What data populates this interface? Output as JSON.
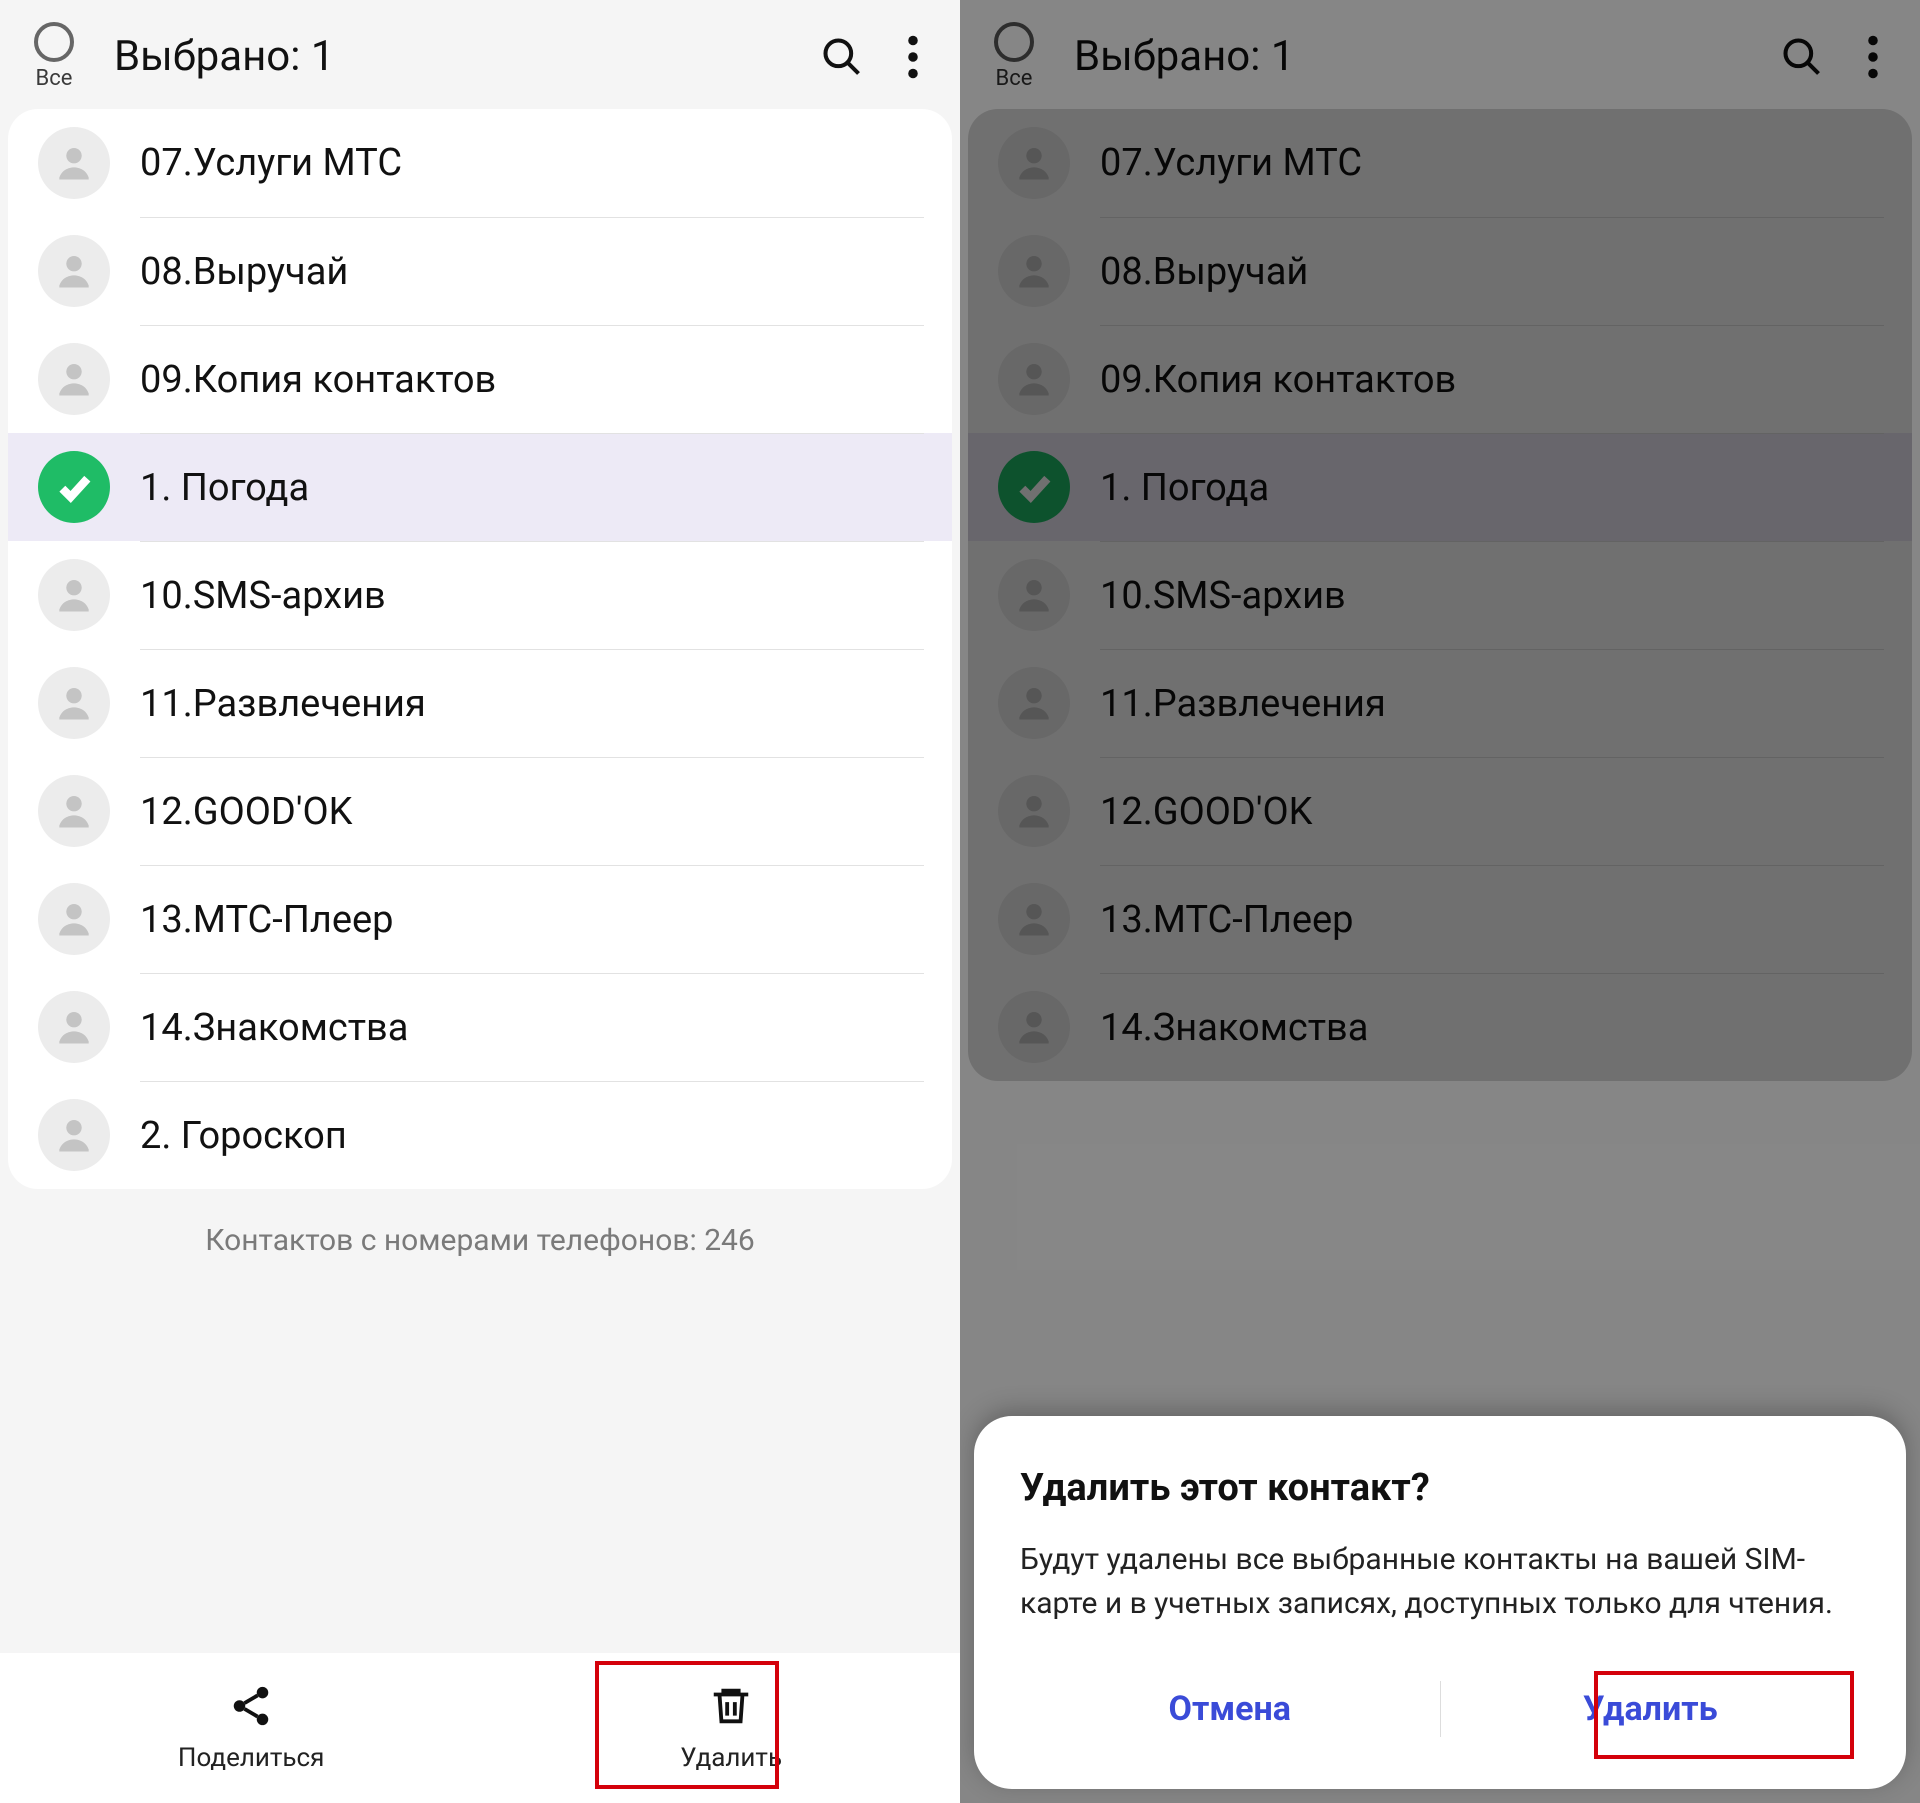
{
  "header": {
    "all_label": "Все",
    "title": "Выбрано: 1"
  },
  "contacts": [
    {
      "name": "07.Услуги МТС",
      "selected": false
    },
    {
      "name": "08.Выручай",
      "selected": false
    },
    {
      "name": "09.Копия контактов",
      "selected": false
    },
    {
      "name": "1. Погода",
      "selected": true
    },
    {
      "name": "10.SMS-архив",
      "selected": false
    },
    {
      "name": "11.Развлечения",
      "selected": false
    },
    {
      "name": "12.GOOD'OK",
      "selected": false
    },
    {
      "name": "13.МТС-Плеер",
      "selected": false
    },
    {
      "name": "14.Знакомства",
      "selected": false
    },
    {
      "name": "2. Гороскоп",
      "selected": false
    }
  ],
  "counter": "Контактов с номерами телефонов: 246",
  "bottom": {
    "share": "Поделиться",
    "delete": "Удалить"
  },
  "dialog": {
    "title": "Удалить этот контакт?",
    "body": "Будут удалены все выбранные контакты на вашей SIM-карте и в учетных записях, доступных только для чтения.",
    "cancel": "Отмена",
    "confirm": "Удалить"
  }
}
